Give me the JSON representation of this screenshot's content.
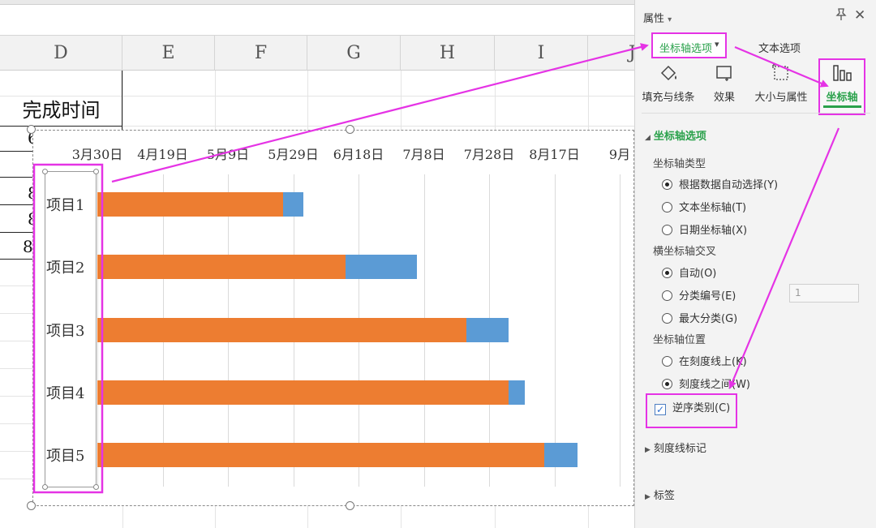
{
  "sheet": {
    "columns": [
      "D",
      "E",
      "F",
      "G",
      "H",
      "I",
      "J"
    ],
    "header_cell": "完成时间",
    "partial_cells": [
      "6",
      "8",
      "8",
      "8",
      "8"
    ]
  },
  "chart_data": {
    "type": "bar",
    "orientation": "horizontal-stacked",
    "title": "",
    "x_ticks": [
      "3月30日",
      "4月19日",
      "5月9日",
      "5月29日",
      "6月18日",
      "7月8日",
      "7月28日",
      "8月17日",
      "9月"
    ],
    "categories": [
      "项目1",
      "项目2",
      "项目3",
      "项目4",
      "项目5"
    ],
    "series": [
      {
        "color": "#ed7d31",
        "values_days_from_axis_start": [
          57,
          76,
          113,
          126,
          137
        ]
      },
      {
        "color": "#5b9bd5",
        "values_days": [
          6,
          22,
          13,
          5,
          10
        ]
      }
    ],
    "axis_range_days": [
      0,
      160
    ],
    "grid": true,
    "reverse_categories": true
  },
  "panel": {
    "title": "属性",
    "title_caret": "▾",
    "pin_icon": "📌",
    "close_icon": "✕",
    "tab_axis_options": "坐标轴选项",
    "tab_caret": "▾",
    "tab_text_options": "文本选项",
    "icon_tabs": [
      "填充与线条",
      "效果",
      "大小与属性",
      "坐标轴"
    ],
    "section_axis_options": "坐标轴选项",
    "axis_type_label": "坐标轴类型",
    "axis_type_options": [
      "根据数据自动选择(Y)",
      "文本坐标轴(T)",
      "日期坐标轴(X)"
    ],
    "cross_label": "横坐标轴交叉",
    "cross_options": [
      "自动(O)",
      "分类编号(E)",
      "最大分类(G)"
    ],
    "category_number_value": "1",
    "position_label": "坐标轴位置",
    "position_options": [
      "在刻度线上(K)",
      "刻度线之间(W)"
    ],
    "reverse_label": "逆序类别(C)",
    "section_tick_marks": "刻度线标记",
    "section_labels": "标签"
  },
  "colors": {
    "accent_green": "#2aa14b",
    "annotation_magenta": "#e533e5",
    "bar_orange": "#ed7d31",
    "bar_blue": "#5b9bd5"
  }
}
